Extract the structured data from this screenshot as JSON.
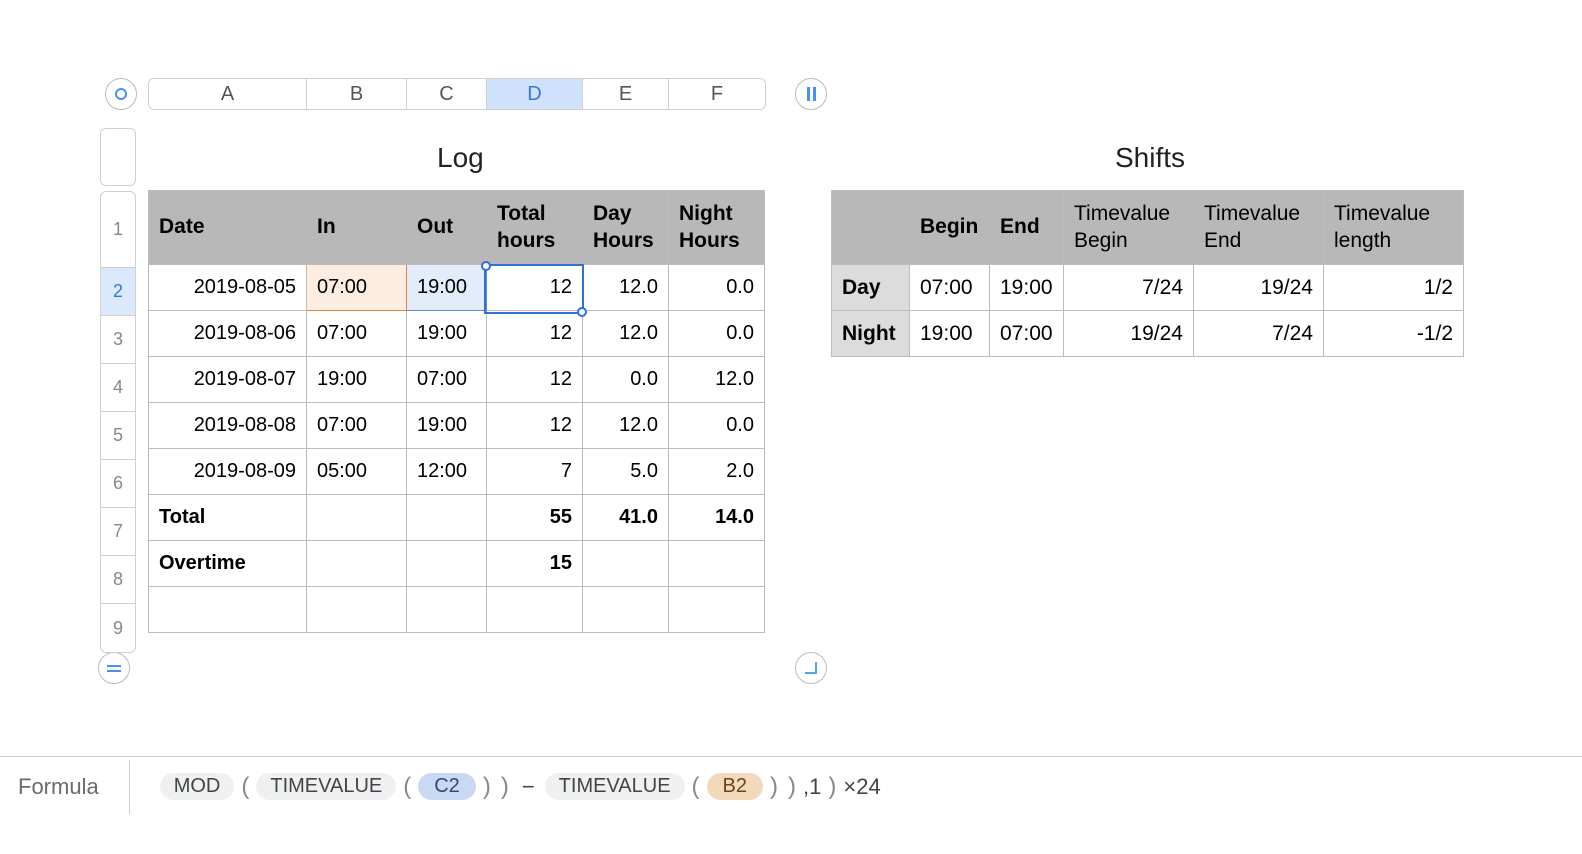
{
  "columns": [
    "A",
    "B",
    "C",
    "D",
    "E",
    "F"
  ],
  "selected_column": "D",
  "rows": [
    1,
    2,
    3,
    4,
    5,
    6,
    7,
    8,
    9
  ],
  "selected_row": 2,
  "log": {
    "title": "Log",
    "headers": {
      "date": "Date",
      "in": "In",
      "out": "Out",
      "total": "Total hours",
      "day": "Day Hours",
      "night": "Night Hours"
    },
    "data": [
      {
        "date": "2019-08-05",
        "in": "07:00",
        "out": "19:00",
        "total": "12",
        "day": "12.0",
        "night": "0.0"
      },
      {
        "date": "2019-08-06",
        "in": "07:00",
        "out": "19:00",
        "total": "12",
        "day": "12.0",
        "night": "0.0"
      },
      {
        "date": "2019-08-07",
        "in": "19:00",
        "out": "07:00",
        "total": "12",
        "day": "0.0",
        "night": "12.0"
      },
      {
        "date": "2019-08-08",
        "in": "07:00",
        "out": "19:00",
        "total": "12",
        "day": "12.0",
        "night": "0.0"
      },
      {
        "date": "2019-08-09",
        "in": "05:00",
        "out": "12:00",
        "total": "7",
        "day": "5.0",
        "night": "2.0"
      }
    ],
    "total": {
      "label": "Total",
      "total": "55",
      "day": "41.0",
      "night": "14.0"
    },
    "overtime": {
      "label": "Overtime",
      "total": "15"
    }
  },
  "shifts": {
    "title": "Shifts",
    "headers": {
      "blank": "",
      "begin": "Begin",
      "end": "End",
      "tvb": "Timevalue Begin",
      "tve": "Timevalue End",
      "tvl": "Timevalue length"
    },
    "rows": [
      {
        "name": "Day",
        "begin": "07:00",
        "end": "19:00",
        "tvb": "7/24",
        "tve": "19/24",
        "tvl": "1/2"
      },
      {
        "name": "Night",
        "begin": "19:00",
        "end": "07:00",
        "tvb": "19/24",
        "tve": "7/24",
        "tvl": "-1/2"
      }
    ]
  },
  "formula": {
    "label": "Formula",
    "mod": "MOD",
    "timevalue": "TIMEVALUE",
    "ref1": "C2",
    "minus": "−",
    "ref2": "B2",
    "comma1": ",1",
    "tail": "×24"
  }
}
